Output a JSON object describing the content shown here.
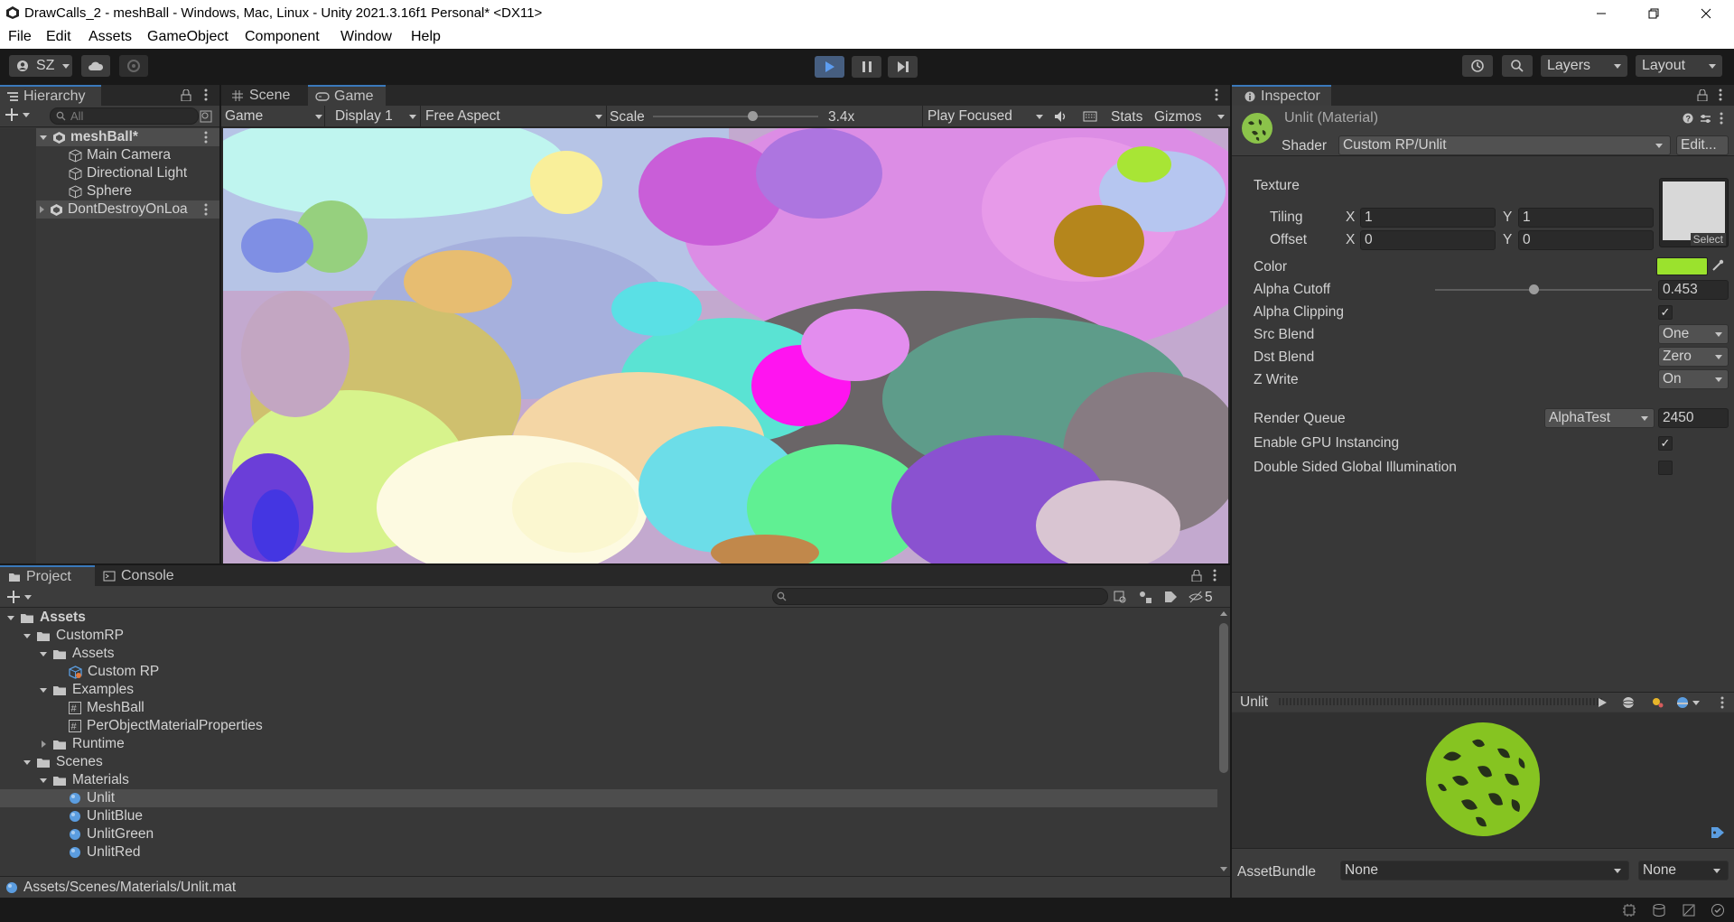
{
  "window": {
    "title": "DrawCalls_2 - meshBall - Windows, Mac, Linux - Unity 2021.3.16f1 Personal* <DX11>"
  },
  "menu": [
    "File",
    "Edit",
    "Assets",
    "GameObject",
    "Component",
    "Window",
    "Help"
  ],
  "toolbar": {
    "account": "SZ",
    "layers": "Layers",
    "layout": "Layout"
  },
  "hierarchy": {
    "tab": "Hierarchy",
    "search_placeholder": "All",
    "items": [
      {
        "label": "meshBall*"
      },
      {
        "label": "Main Camera"
      },
      {
        "label": "Directional Light"
      },
      {
        "label": "Sphere"
      },
      {
        "label": "DontDestroyOnLoa"
      }
    ]
  },
  "viewport": {
    "tabs": [
      "Scene",
      "Game"
    ],
    "game_dropdown": "Game",
    "display": "Display 1",
    "aspect": "Free Aspect",
    "scale_label": "Scale",
    "scale_value": "3.4x",
    "scale_fraction": 0.6,
    "play_mode": "Play Focused",
    "stats": "Stats",
    "gizmos": "Gizmos"
  },
  "inspector": {
    "tab": "Inspector",
    "material_name": "Unlit (Material)",
    "shader_label": "Shader",
    "shader_value": "Custom RP/Unlit",
    "edit_button": "Edit...",
    "texture_label": "Texture",
    "select_label": "Select",
    "tiling_label": "Tiling",
    "offset_label": "Offset",
    "x": "X",
    "y": "Y",
    "tiling_x": "1",
    "tiling_y": "1",
    "offset_x": "0",
    "offset_y": "0",
    "color_label": "Color",
    "color_value": "#9be22d",
    "alpha_cutoff_label": "Alpha Cutoff",
    "alpha_cutoff_value": "0.453",
    "alpha_clipping_label": "Alpha Clipping",
    "alpha_clipping_checked": true,
    "src_blend_label": "Src Blend",
    "src_blend_value": "One",
    "dst_blend_label": "Dst Blend",
    "dst_blend_value": "Zero",
    "zwrite_label": "Z Write",
    "zwrite_value": "On",
    "render_queue_label": "Render Queue",
    "render_queue_mode": "AlphaTest",
    "render_queue_value": "2450",
    "gpu_instancing_label": "Enable GPU Instancing",
    "gpu_instancing_checked": true,
    "double_sided_label": "Double Sided Global Illumination",
    "double_sided_checked": false,
    "preview_title": "Unlit",
    "assetbundle_label": "AssetBundle",
    "assetbundle_value": "None",
    "assetbundle_variant": "None"
  },
  "project": {
    "tabs": [
      "Project",
      "Console"
    ],
    "hidden_count": "5",
    "tree": [
      {
        "label": "Assets",
        "depth": 0,
        "kind": "folder",
        "open": true
      },
      {
        "label": "CustomRP",
        "depth": 1,
        "kind": "folder",
        "open": true
      },
      {
        "label": "Assets",
        "depth": 2,
        "kind": "folder",
        "open": true
      },
      {
        "label": "Custom RP",
        "depth": 3,
        "kind": "asset"
      },
      {
        "label": "Examples",
        "depth": 2,
        "kind": "folder",
        "open": true
      },
      {
        "label": "MeshBall",
        "depth": 3,
        "kind": "script"
      },
      {
        "label": "PerObjectMaterialProperties",
        "depth": 3,
        "kind": "script"
      },
      {
        "label": "Runtime",
        "depth": 2,
        "kind": "folder",
        "open": false
      },
      {
        "label": "Scenes",
        "depth": 1,
        "kind": "folder",
        "open": true
      },
      {
        "label": "Materials",
        "depth": 2,
        "kind": "folder",
        "open": true
      },
      {
        "label": "Unlit",
        "depth": 3,
        "kind": "material",
        "selected": true
      },
      {
        "label": "UnlitBlue",
        "depth": 3,
        "kind": "material"
      },
      {
        "label": "UnlitGreen",
        "depth": 3,
        "kind": "material"
      },
      {
        "label": "UnlitRed",
        "depth": 3,
        "kind": "material"
      }
    ],
    "path": "Assets/Scenes/Materials/Unlit.mat"
  }
}
